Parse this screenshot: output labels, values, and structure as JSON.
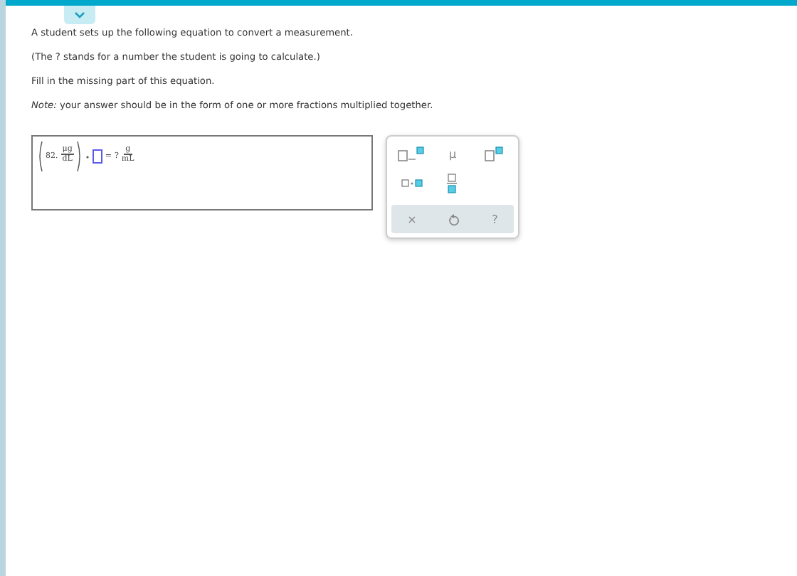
{
  "instructions": [
    "A student sets up the following equation to convert a measurement.",
    "(The ? stands for a number the student is going to calculate.)",
    "Fill in the missing part of this equation."
  ],
  "note": {
    "label": "Note:",
    "text": "your answer should be in the form of one or more fractions multiplied together."
  },
  "equation": {
    "value": "82.",
    "numerator": "μg",
    "denominator": "dL",
    "equals": "=",
    "unknown": "?",
    "result_numerator": "g",
    "result_denominator": "mL"
  },
  "toolbar": {
    "mu": "μ",
    "clear": "×",
    "help": "?"
  }
}
